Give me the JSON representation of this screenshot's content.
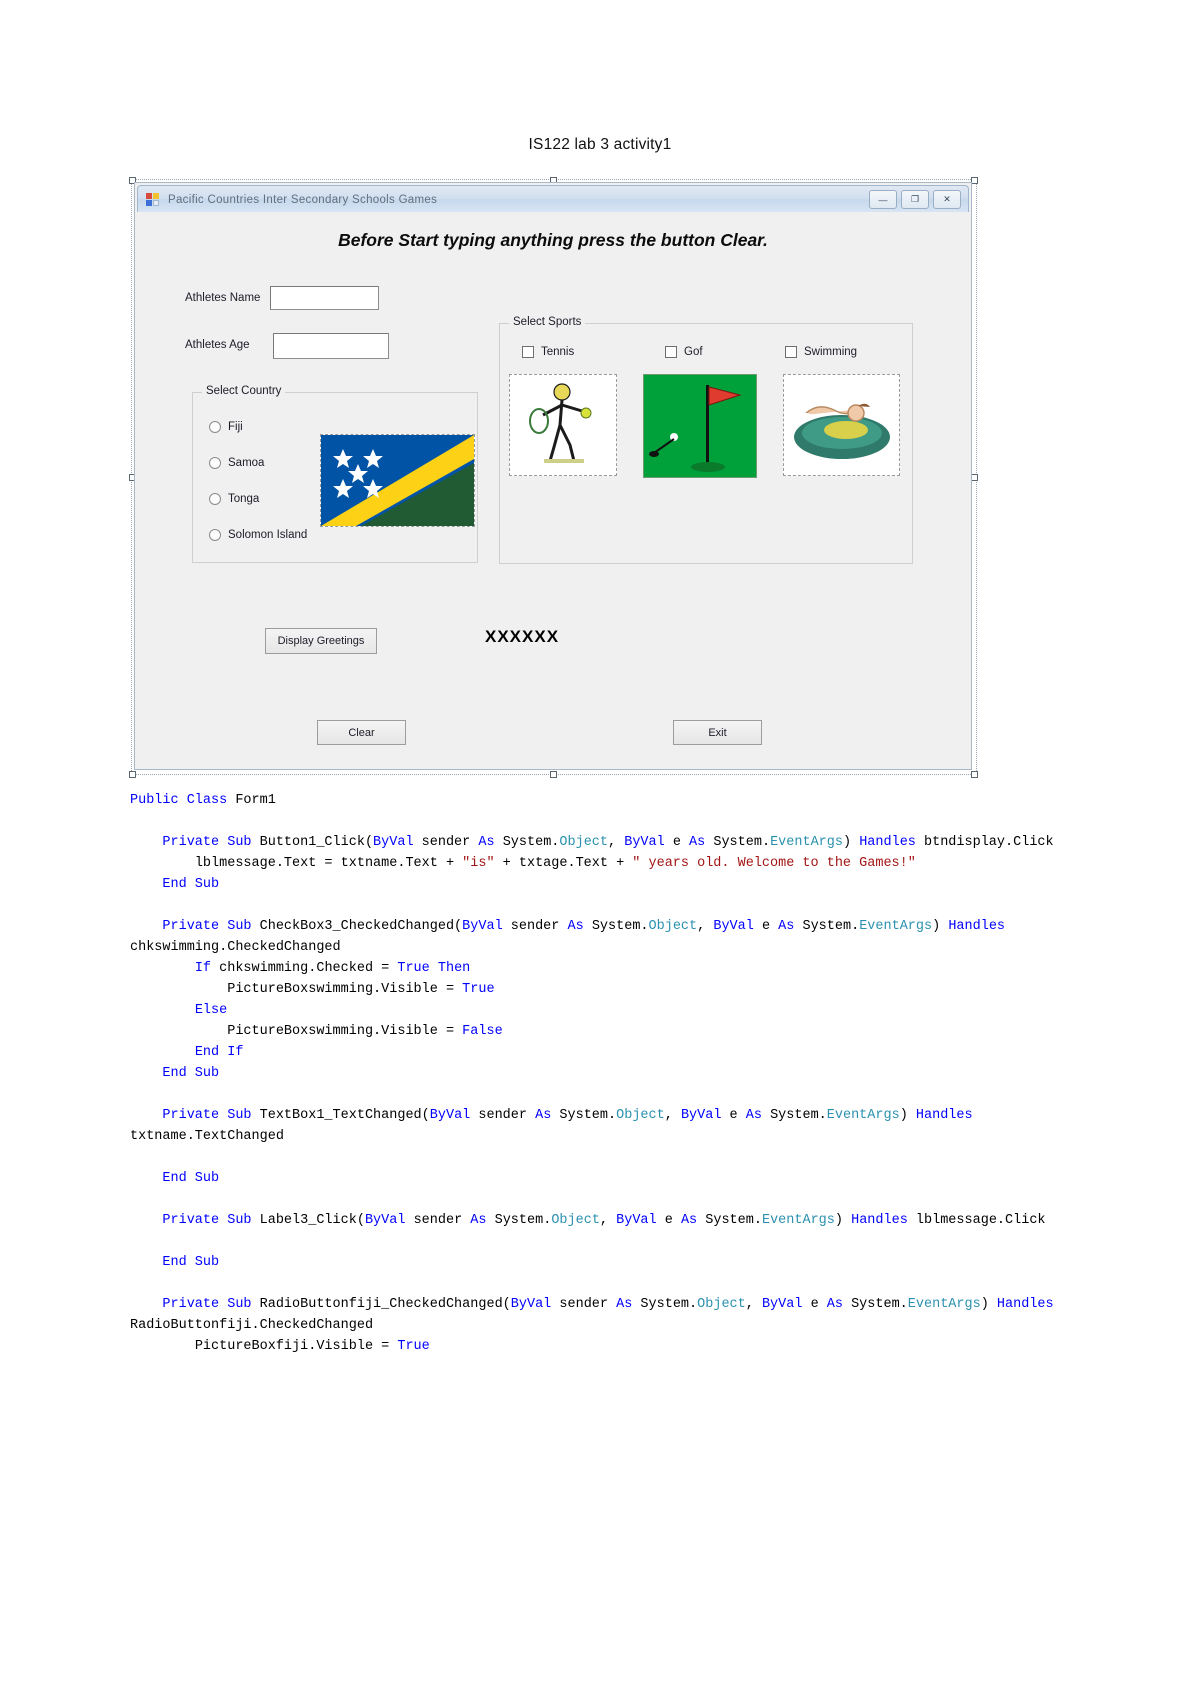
{
  "document": {
    "title": "IS122 lab 3 activity1"
  },
  "window": {
    "title": "Pacific Countries Inter Secondary Schools  Games",
    "icon": "vb-form-icon",
    "controls": {
      "minimize": "—",
      "maximize": "❐",
      "close": "✕"
    }
  },
  "form": {
    "banner": "Before Start typing anything press the button Clear.",
    "fields": [
      {
        "label": "Athletes Name",
        "value": "",
        "placeholder": ""
      },
      {
        "label": "Athletes Age",
        "value": "",
        "placeholder": ""
      }
    ],
    "country_group": {
      "title": "Select Country",
      "options": [
        {
          "label": "Fiji",
          "checked": false
        },
        {
          "label": "Samoa",
          "checked": false
        },
        {
          "label": "Tonga",
          "checked": false
        },
        {
          "label": "Solomon Island",
          "checked": false
        }
      ],
      "flag_image": "solomon-islands-flag"
    },
    "sports_group": {
      "title": "Select Sports",
      "options": [
        {
          "label": "Tennis",
          "checked": false,
          "image": "tennis-player-image"
        },
        {
          "label": "Gof",
          "checked": false,
          "image": "golf-green-flag-image"
        },
        {
          "label": "Swimming",
          "checked": false,
          "image": "swimmer-image"
        }
      ]
    },
    "buttons": {
      "display": "Display Greetings",
      "clear": "Clear",
      "exit": "Exit"
    },
    "message_label": "XXXXXX"
  },
  "code": {
    "lines": [
      [
        {
          "t": "Public Class ",
          "c": "kw"
        },
        {
          "t": "Form1",
          "c": "pl"
        }
      ],
      [],
      [
        {
          "t": "    Private Sub ",
          "c": "kw"
        },
        {
          "t": "Button1_Click(",
          "c": "pl"
        },
        {
          "t": "ByVal ",
          "c": "kw"
        },
        {
          "t": "sender ",
          "c": "pl"
        },
        {
          "t": "As ",
          "c": "kw"
        },
        {
          "t": "System.",
          "c": "pl"
        },
        {
          "t": "Object",
          "c": "ty"
        },
        {
          "t": ", ",
          "c": "pl"
        },
        {
          "t": "ByVal ",
          "c": "kw"
        },
        {
          "t": "e ",
          "c": "pl"
        },
        {
          "t": "As ",
          "c": "kw"
        },
        {
          "t": "System.",
          "c": "pl"
        },
        {
          "t": "EventArgs",
          "c": "ty"
        },
        {
          "t": ") ",
          "c": "pl"
        },
        {
          "t": "Handles ",
          "c": "kw"
        },
        {
          "t": "btndisplay.Click",
          "c": "pl"
        }
      ],
      [
        {
          "t": "        lblmessage.Text = txtname.Text + ",
          "c": "pl"
        },
        {
          "t": "\"is\"",
          "c": "st"
        },
        {
          "t": " + txtage.Text + ",
          "c": "pl"
        },
        {
          "t": "\" years old. Welcome to the Games!\"",
          "c": "st"
        }
      ],
      [
        {
          "t": "    End Sub",
          "c": "kw"
        }
      ],
      [],
      [
        {
          "t": "    Private Sub ",
          "c": "kw"
        },
        {
          "t": "CheckBox3_CheckedChanged(",
          "c": "pl"
        },
        {
          "t": "ByVal ",
          "c": "kw"
        },
        {
          "t": "sender ",
          "c": "pl"
        },
        {
          "t": "As ",
          "c": "kw"
        },
        {
          "t": "System.",
          "c": "pl"
        },
        {
          "t": "Object",
          "c": "ty"
        },
        {
          "t": ", ",
          "c": "pl"
        },
        {
          "t": "ByVal ",
          "c": "kw"
        },
        {
          "t": "e ",
          "c": "pl"
        },
        {
          "t": "As ",
          "c": "kw"
        },
        {
          "t": "System.",
          "c": "pl"
        },
        {
          "t": "EventArgs",
          "c": "ty"
        },
        {
          "t": ") ",
          "c": "pl"
        },
        {
          "t": "Handles ",
          "c": "kw"
        },
        {
          "t": "chkswimming.CheckedChanged",
          "c": "pl"
        }
      ],
      [
        {
          "t": "        If ",
          "c": "kw"
        },
        {
          "t": "chkswimming.Checked = ",
          "c": "pl"
        },
        {
          "t": "True Then",
          "c": "kw"
        }
      ],
      [
        {
          "t": "            PictureBoxswimming.Visible = ",
          "c": "pl"
        },
        {
          "t": "True",
          "c": "kw"
        }
      ],
      [
        {
          "t": "        Else",
          "c": "kw"
        }
      ],
      [
        {
          "t": "            PictureBoxswimming.Visible = ",
          "c": "pl"
        },
        {
          "t": "False",
          "c": "kw"
        }
      ],
      [
        {
          "t": "        End If",
          "c": "kw"
        }
      ],
      [
        {
          "t": "    End Sub",
          "c": "kw"
        }
      ],
      [],
      [
        {
          "t": "    Private Sub ",
          "c": "kw"
        },
        {
          "t": "TextBox1_TextChanged(",
          "c": "pl"
        },
        {
          "t": "ByVal ",
          "c": "kw"
        },
        {
          "t": "sender ",
          "c": "pl"
        },
        {
          "t": "As ",
          "c": "kw"
        },
        {
          "t": "System.",
          "c": "pl"
        },
        {
          "t": "Object",
          "c": "ty"
        },
        {
          "t": ", ",
          "c": "pl"
        },
        {
          "t": "ByVal ",
          "c": "kw"
        },
        {
          "t": "e ",
          "c": "pl"
        },
        {
          "t": "As ",
          "c": "kw"
        },
        {
          "t": "System.",
          "c": "pl"
        },
        {
          "t": "EventArgs",
          "c": "ty"
        },
        {
          "t": ") ",
          "c": "pl"
        },
        {
          "t": "Handles ",
          "c": "kw"
        },
        {
          "t": "txtname.TextChanged",
          "c": "pl"
        }
      ],
      [],
      [
        {
          "t": "    End Sub",
          "c": "kw"
        }
      ],
      [],
      [
        {
          "t": "    Private Sub ",
          "c": "kw"
        },
        {
          "t": "Label3_Click(",
          "c": "pl"
        },
        {
          "t": "ByVal ",
          "c": "kw"
        },
        {
          "t": "sender ",
          "c": "pl"
        },
        {
          "t": "As ",
          "c": "kw"
        },
        {
          "t": "System.",
          "c": "pl"
        },
        {
          "t": "Object",
          "c": "ty"
        },
        {
          "t": ", ",
          "c": "pl"
        },
        {
          "t": "ByVal ",
          "c": "kw"
        },
        {
          "t": "e ",
          "c": "pl"
        },
        {
          "t": "As ",
          "c": "kw"
        },
        {
          "t": "System.",
          "c": "pl"
        },
        {
          "t": "EventArgs",
          "c": "ty"
        },
        {
          "t": ") ",
          "c": "pl"
        },
        {
          "t": "Handles ",
          "c": "kw"
        },
        {
          "t": "lblmessage.Click",
          "c": "pl"
        }
      ],
      [],
      [
        {
          "t": "    End Sub",
          "c": "kw"
        }
      ],
      [],
      [
        {
          "t": "    Private Sub ",
          "c": "kw"
        },
        {
          "t": "RadioButtonfiji_CheckedChanged(",
          "c": "pl"
        },
        {
          "t": "ByVal ",
          "c": "kw"
        },
        {
          "t": "sender ",
          "c": "pl"
        },
        {
          "t": "As ",
          "c": "kw"
        },
        {
          "t": "System.",
          "c": "pl"
        },
        {
          "t": "Object",
          "c": "ty"
        },
        {
          "t": ", ",
          "c": "pl"
        },
        {
          "t": "ByVal ",
          "c": "kw"
        },
        {
          "t": "e ",
          "c": "pl"
        },
        {
          "t": "As ",
          "c": "kw"
        },
        {
          "t": "System.",
          "c": "pl"
        },
        {
          "t": "EventArgs",
          "c": "ty"
        },
        {
          "t": ") ",
          "c": "pl"
        },
        {
          "t": "Handles ",
          "c": "kw"
        },
        {
          "t": "RadioButtonfiji.CheckedChanged",
          "c": "pl"
        }
      ],
      [
        {
          "t": "        PictureBoxfiji.Visible = ",
          "c": "pl"
        },
        {
          "t": "True",
          "c": "kw"
        }
      ]
    ]
  },
  "colors": {
    "keyword": "#0000ff",
    "type": "#2b91af",
    "string": "#a31515",
    "form_bg": "#f0f0f0",
    "titlebar": "#d2dfef"
  }
}
